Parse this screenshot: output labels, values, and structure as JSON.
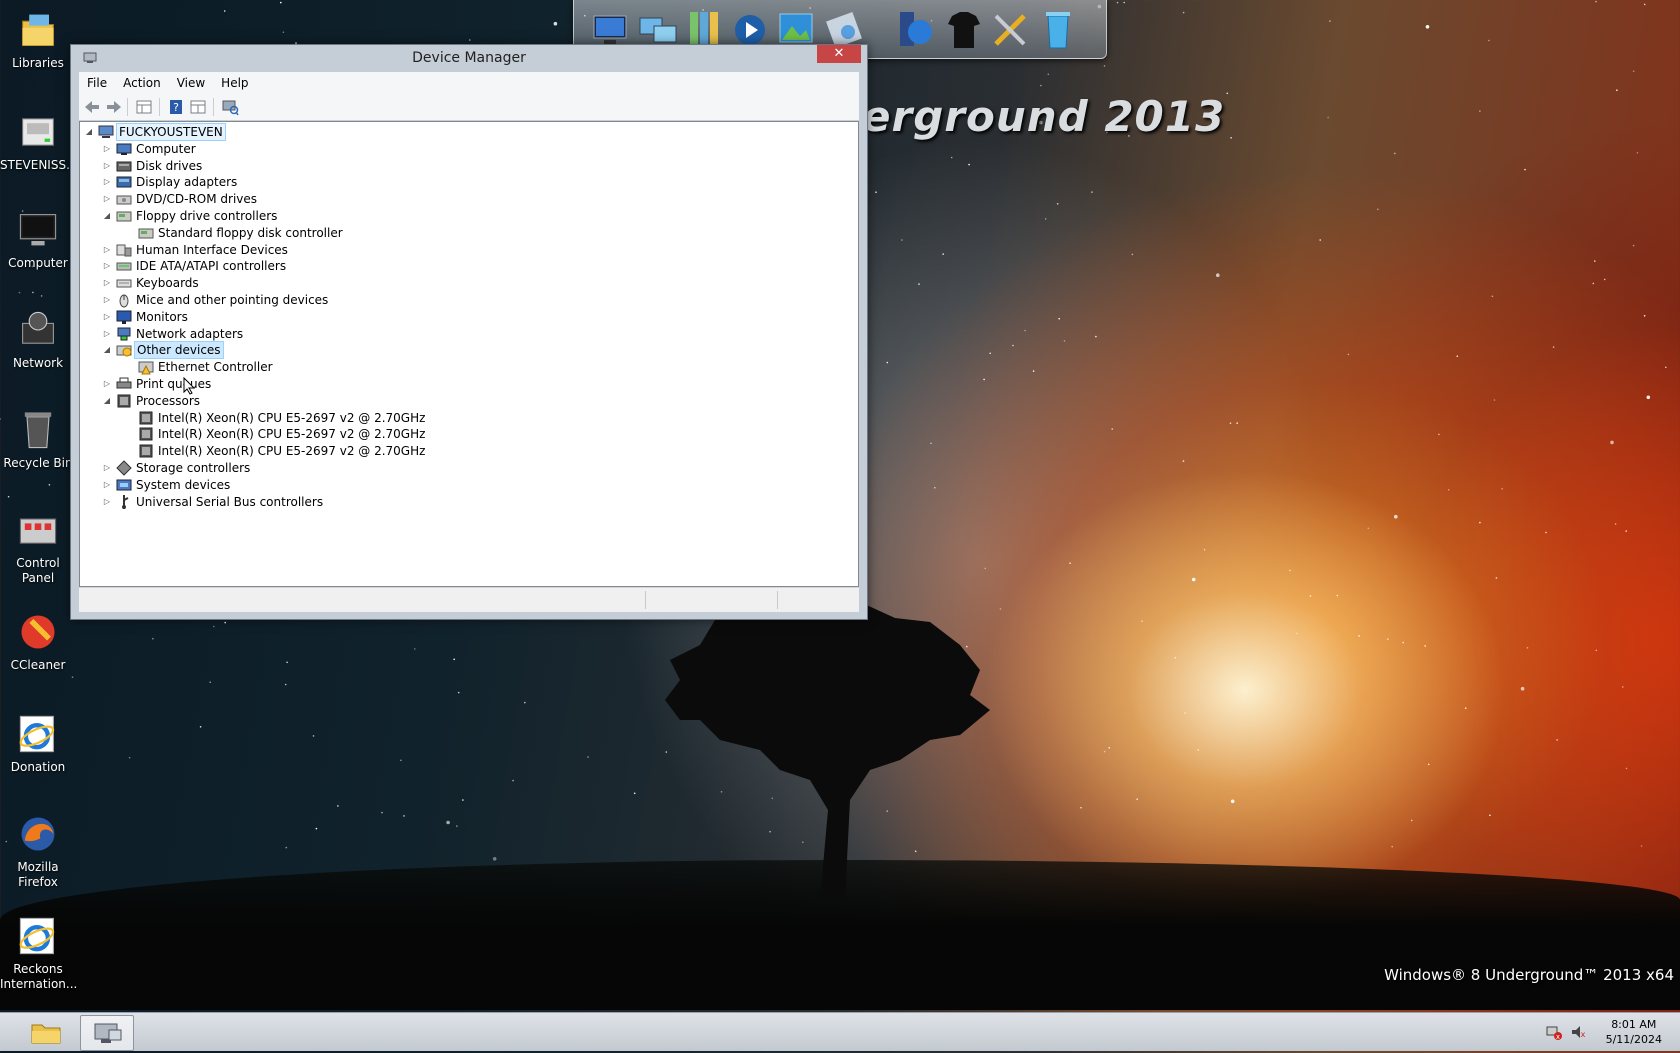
{
  "desktop": {
    "icons": [
      {
        "label": "Libraries",
        "icon": "libraries-icon"
      },
      {
        "label": "STEVENISS...",
        "icon": "drive-icon"
      },
      {
        "label": "Computer",
        "icon": "computer-icon"
      },
      {
        "label": "Network",
        "icon": "network-icon"
      },
      {
        "label": "Recycle Bin",
        "icon": "recycle-bin-icon"
      },
      {
        "label": "Control Panel",
        "icon": "control-panel-icon"
      },
      {
        "label": "CCleaner",
        "icon": "ccleaner-icon"
      },
      {
        "label": "Donation",
        "icon": "ie-icon"
      },
      {
        "label": "Mozilla Firefox",
        "icon": "firefox-icon"
      },
      {
        "label": "Reckons Internation...",
        "icon": "ie-icon"
      }
    ],
    "wallpaper_text": "erground 2013",
    "watermark": "Windows® 8 Underground™ 2013 x64"
  },
  "window": {
    "title": "Device Manager",
    "close_glyph": "✕",
    "menu": [
      "File",
      "Action",
      "View",
      "Help"
    ],
    "tree": {
      "root": "FUCKYOUSTEVEN",
      "items": [
        {
          "label": "Computer",
          "icon": "computer-icon",
          "expanded": false
        },
        {
          "label": "Disk drives",
          "icon": "disk-drive-icon",
          "expanded": false
        },
        {
          "label": "Display adapters",
          "icon": "display-adapter-icon",
          "expanded": false
        },
        {
          "label": "DVD/CD-ROM drives",
          "icon": "dvd-drive-icon",
          "expanded": false
        },
        {
          "label": "Floppy drive controllers",
          "icon": "floppy-controller-icon",
          "expanded": true
        },
        {
          "label": "Standard floppy disk controller",
          "icon": "floppy-controller-icon",
          "child": true
        },
        {
          "label": "Human Interface Devices",
          "icon": "hid-icon",
          "expanded": false
        },
        {
          "label": "IDE ATA/ATAPI controllers",
          "icon": "ide-controller-icon",
          "expanded": false
        },
        {
          "label": "Keyboards",
          "icon": "keyboard-icon",
          "expanded": false
        },
        {
          "label": "Mice and other pointing devices",
          "icon": "mouse-icon",
          "expanded": false
        },
        {
          "label": "Monitors",
          "icon": "monitor-icon",
          "expanded": false
        },
        {
          "label": "Network adapters",
          "icon": "network-adapter-icon",
          "expanded": false
        },
        {
          "label": "Other devices",
          "icon": "unknown-device-icon",
          "expanded": true,
          "selected": true
        },
        {
          "label": "Ethernet Controller",
          "icon": "warning-device-icon",
          "child": true
        },
        {
          "label": "Print queues",
          "icon": "printer-icon",
          "expanded": false
        },
        {
          "label": "Processors",
          "icon": "processor-icon",
          "expanded": true
        },
        {
          "label": "Intel(R) Xeon(R) CPU E5-2697 v2 @ 2.70GHz",
          "icon": "processor-icon",
          "child": true
        },
        {
          "label": "Intel(R) Xeon(R) CPU E5-2697 v2 @ 2.70GHz",
          "icon": "processor-icon",
          "child": true
        },
        {
          "label": "Intel(R) Xeon(R) CPU E5-2697 v2 @ 2.70GHz",
          "icon": "processor-icon",
          "child": true
        },
        {
          "label": "Storage controllers",
          "icon": "storage-controller-icon",
          "expanded": false
        },
        {
          "label": "System devices",
          "icon": "system-device-icon",
          "expanded": false
        },
        {
          "label": "Universal Serial Bus controllers",
          "icon": "usb-icon",
          "expanded": false
        }
      ]
    }
  },
  "taskbar": {
    "time": "8:01 AM",
    "date": "5/11/2024"
  },
  "colors": {
    "selection": "#cce8ff",
    "selection_border": "#99d1ff",
    "close_button": "#c74545"
  }
}
